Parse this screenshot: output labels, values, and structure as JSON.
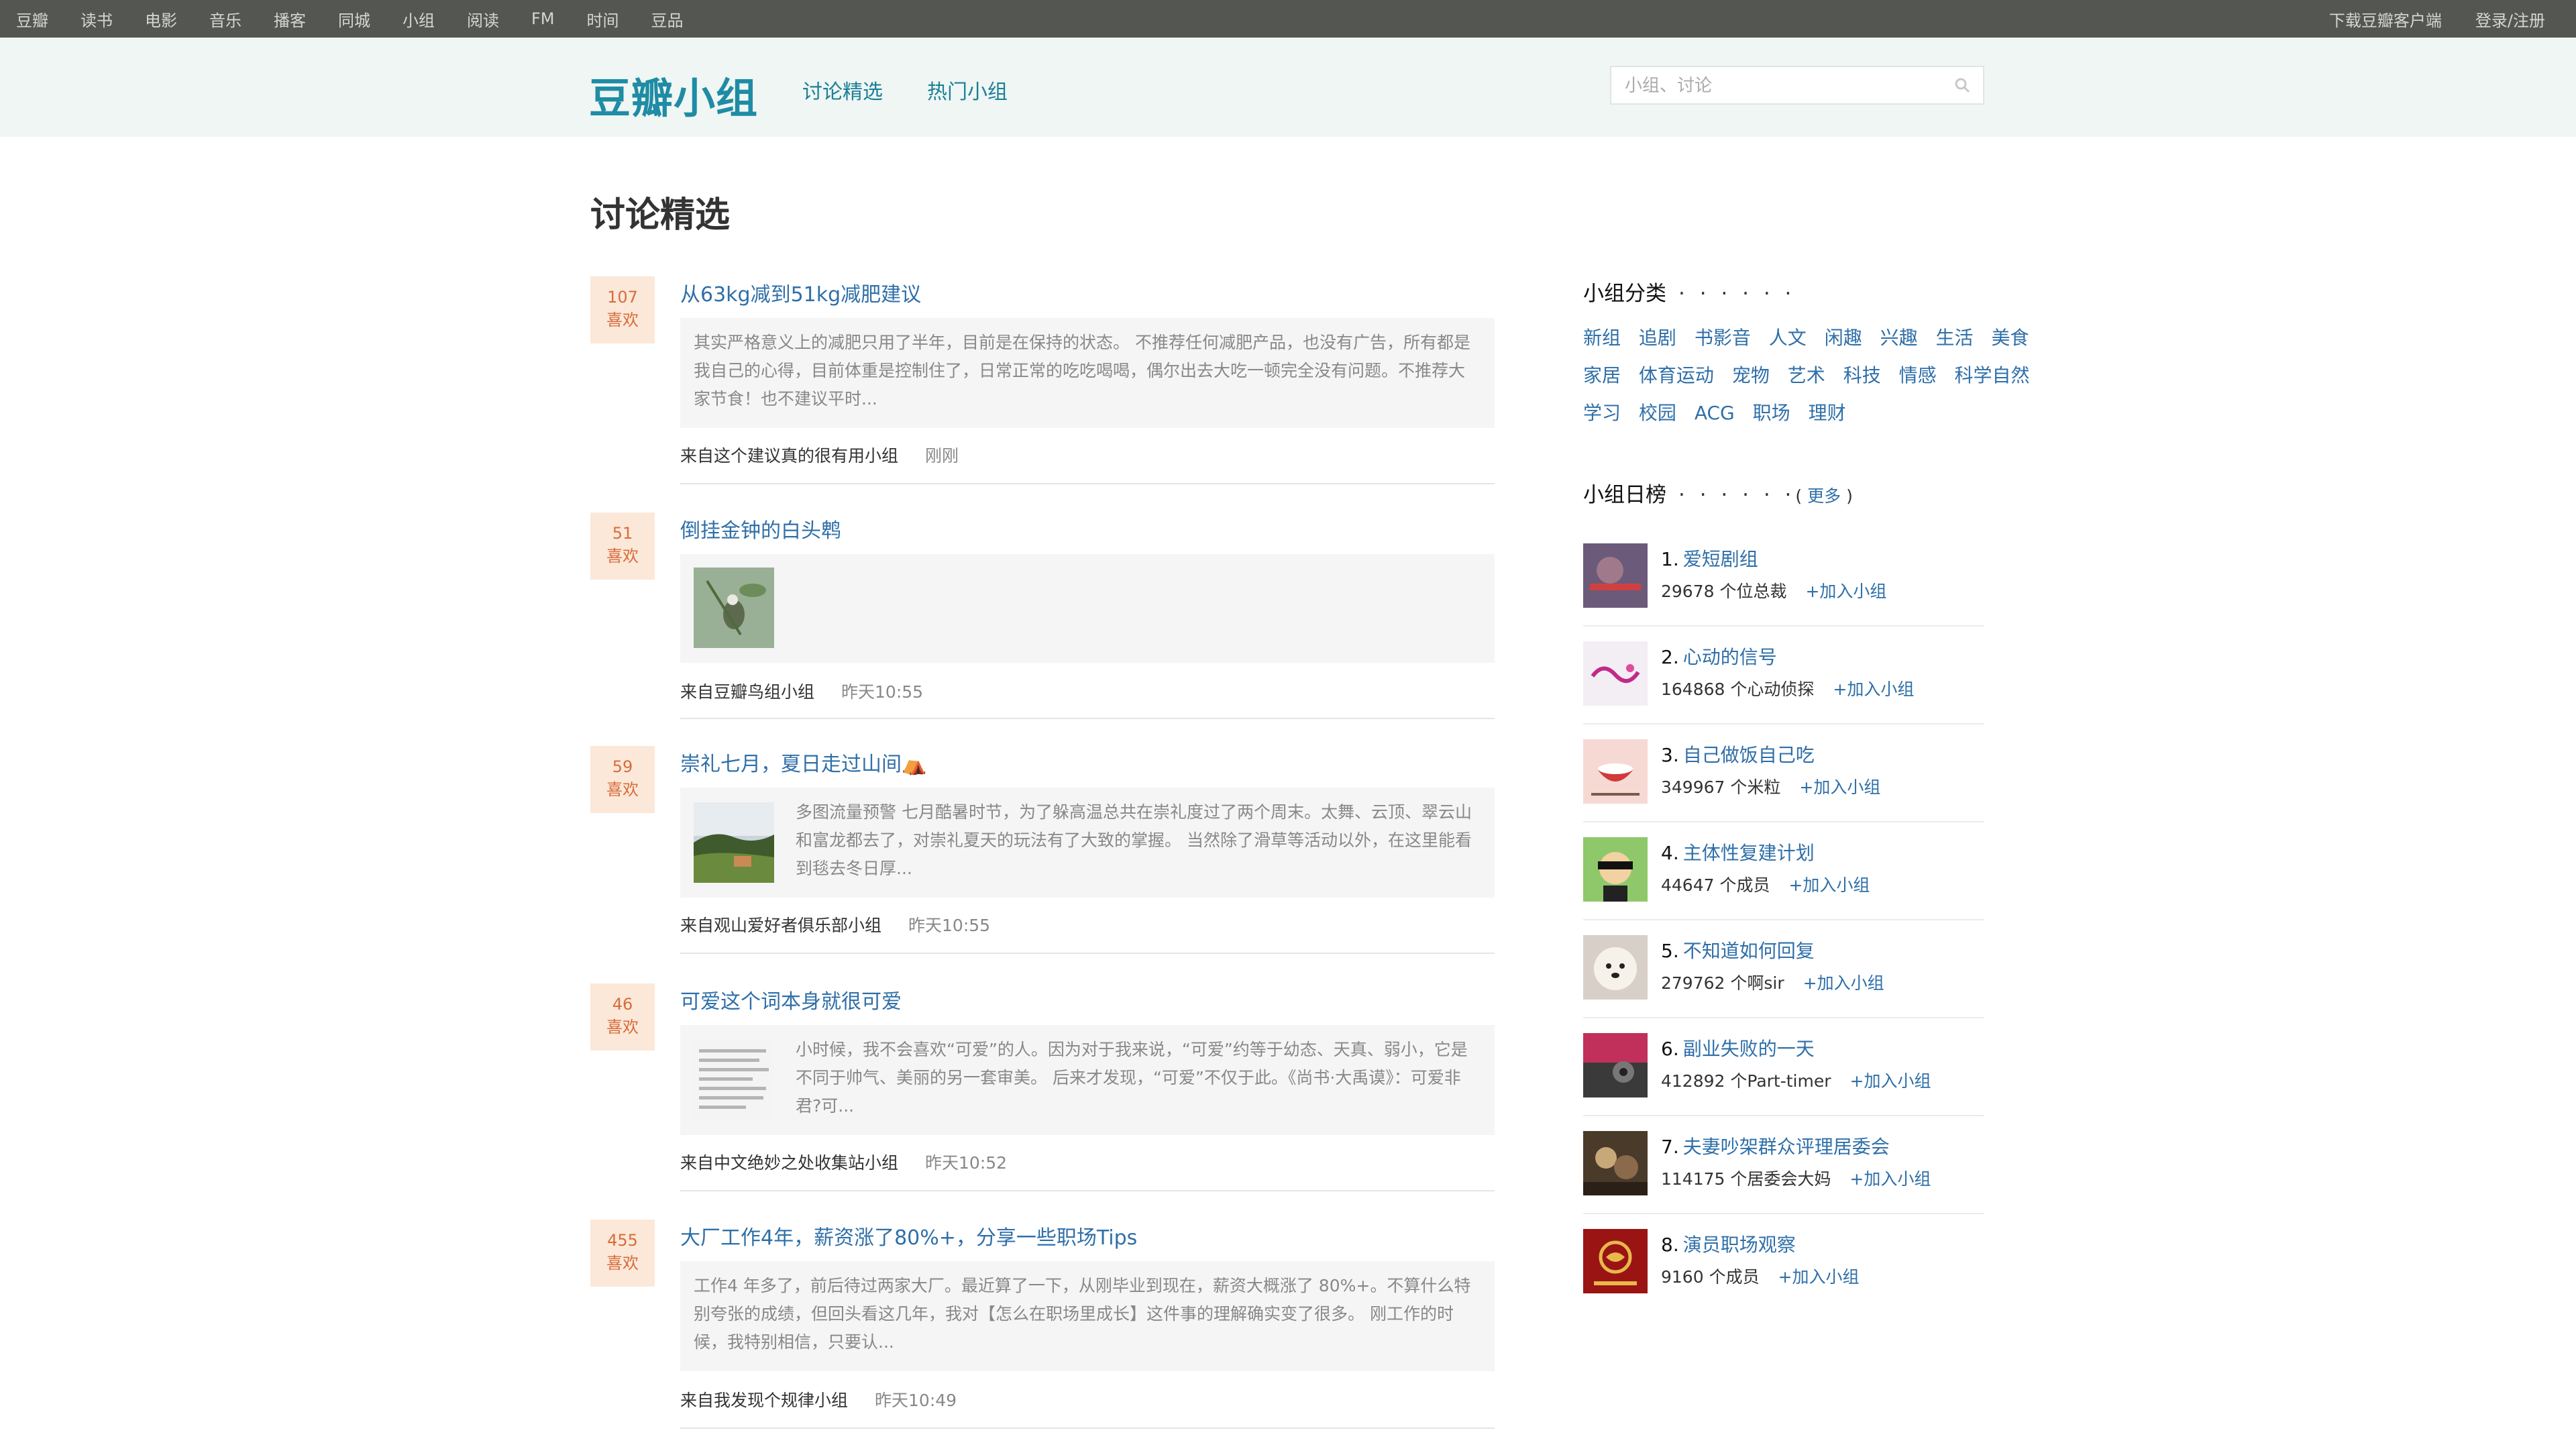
{
  "global_nav": {
    "left": [
      "豆瓣",
      "读书",
      "电影",
      "音乐",
      "播客",
      "同城",
      "小组",
      "阅读",
      "FM",
      "时间",
      "豆品"
    ],
    "download": "下载豆瓣客户端",
    "login": "登录/注册"
  },
  "header": {
    "logo": "豆瓣小组",
    "nav": [
      "讨论精选",
      "热门小组"
    ],
    "search_placeholder": "小组、讨论"
  },
  "page_title": "讨论精选",
  "like_unit": "喜欢",
  "topics": [
    {
      "likes": "107",
      "title": "从63kg减到51kg减肥建议",
      "excerpt": "其实严格意义上的减肥只用了半年，目前是在保持的状态。 不推荐任何减肥产品，也没有广告，所有都是我自己的心得，目前体重是控制住了，日常正常的吃吃喝喝，偶尔出去大吃一顿完全没有问题。不推荐大家节食！也不建议平时...",
      "group": "来自这个建议真的很有用小组",
      "time": "刚刚"
    },
    {
      "likes": "51",
      "title": "倒挂金钟的白头鹎",
      "excerpt": "",
      "group": "来自豆瓣鸟组小组",
      "time": "昨天10:55"
    },
    {
      "likes": "59",
      "title": "崇礼七月，夏日走过山间⛺",
      "excerpt": "多图流量预警 七月酷暑时节，为了躲高温总共在崇礼度过了两个周末。太舞、云顶、翠云山和富龙都去了，对崇礼夏天的玩法有了大致的掌握。 当然除了滑草等活动以外，在这里能看到毯去冬日厚...",
      "group": "来自观山爱好者俱乐部小组",
      "time": "昨天10:55"
    },
    {
      "likes": "46",
      "title": "可爱这个词本身就很可爱",
      "excerpt": "小时候，我不会喜欢“可爱”的人。因为对于我来说，“可爱”约等于幼态、天真、弱小，它是不同于帅气、美丽的另一套审美。 后来才发现，“可爱”不仅于此。《尚书·大禹谟》：可爱非君?可...",
      "group": "来自中文绝妙之处收集站小组",
      "time": "昨天10:52"
    },
    {
      "likes": "455",
      "title": "大厂工作4年，薪资涨了80%+，分享一些职场Tips",
      "excerpt": "工作4 年多了，前后待过两家大厂。最近算了一下，从刚毕业到现在，薪资大概涨了 80%+。不算什么特别夸张的成绩，但回头看这几年，我对【怎么在职场里成长】这件事的理解确实变了很多。 刚工作的时候，我特别相信，只要认...",
      "group": "来自我发现个规律小组",
      "time": "昨天10:49"
    }
  ],
  "sidebar": {
    "categories_title": "小组分类",
    "dots": "· · · · · ·",
    "categories": [
      [
        "新组",
        "追剧",
        "书影音",
        "人文",
        "闲趣",
        "兴趣",
        "生活",
        "美食"
      ],
      [
        "家居",
        "体育运动",
        "宠物",
        "艺术",
        "科技",
        "情感",
        "科学自然"
      ],
      [
        "学习",
        "校园",
        "ACG",
        "职场",
        "理财"
      ]
    ],
    "rank_title": "小组日榜",
    "rank_more": "更多",
    "join_label": "+加入小组",
    "rank": [
      {
        "no": "1.",
        "name": "爱短剧组",
        "count": "29678 个位总裁"
      },
      {
        "no": "2.",
        "name": "心动的信号",
        "count": "164868 个心动侦探"
      },
      {
        "no": "3.",
        "name": "自己做饭自己吃",
        "count": "349967 个米粒"
      },
      {
        "no": "4.",
        "name": "主体性复建计划",
        "count": "44647 个成员"
      },
      {
        "no": "5.",
        "name": "不知道如何回复",
        "count": "279762 个啊sir"
      },
      {
        "no": "6.",
        "name": "副业失败的一天",
        "count": "412892 个Part-timer"
      },
      {
        "no": "7.",
        "name": "夫妻吵架群众评理居委会",
        "count": "114175 个居委会大妈"
      },
      {
        "no": "8.",
        "name": "演员职场观察",
        "count": "9160 个成员"
      }
    ]
  }
}
